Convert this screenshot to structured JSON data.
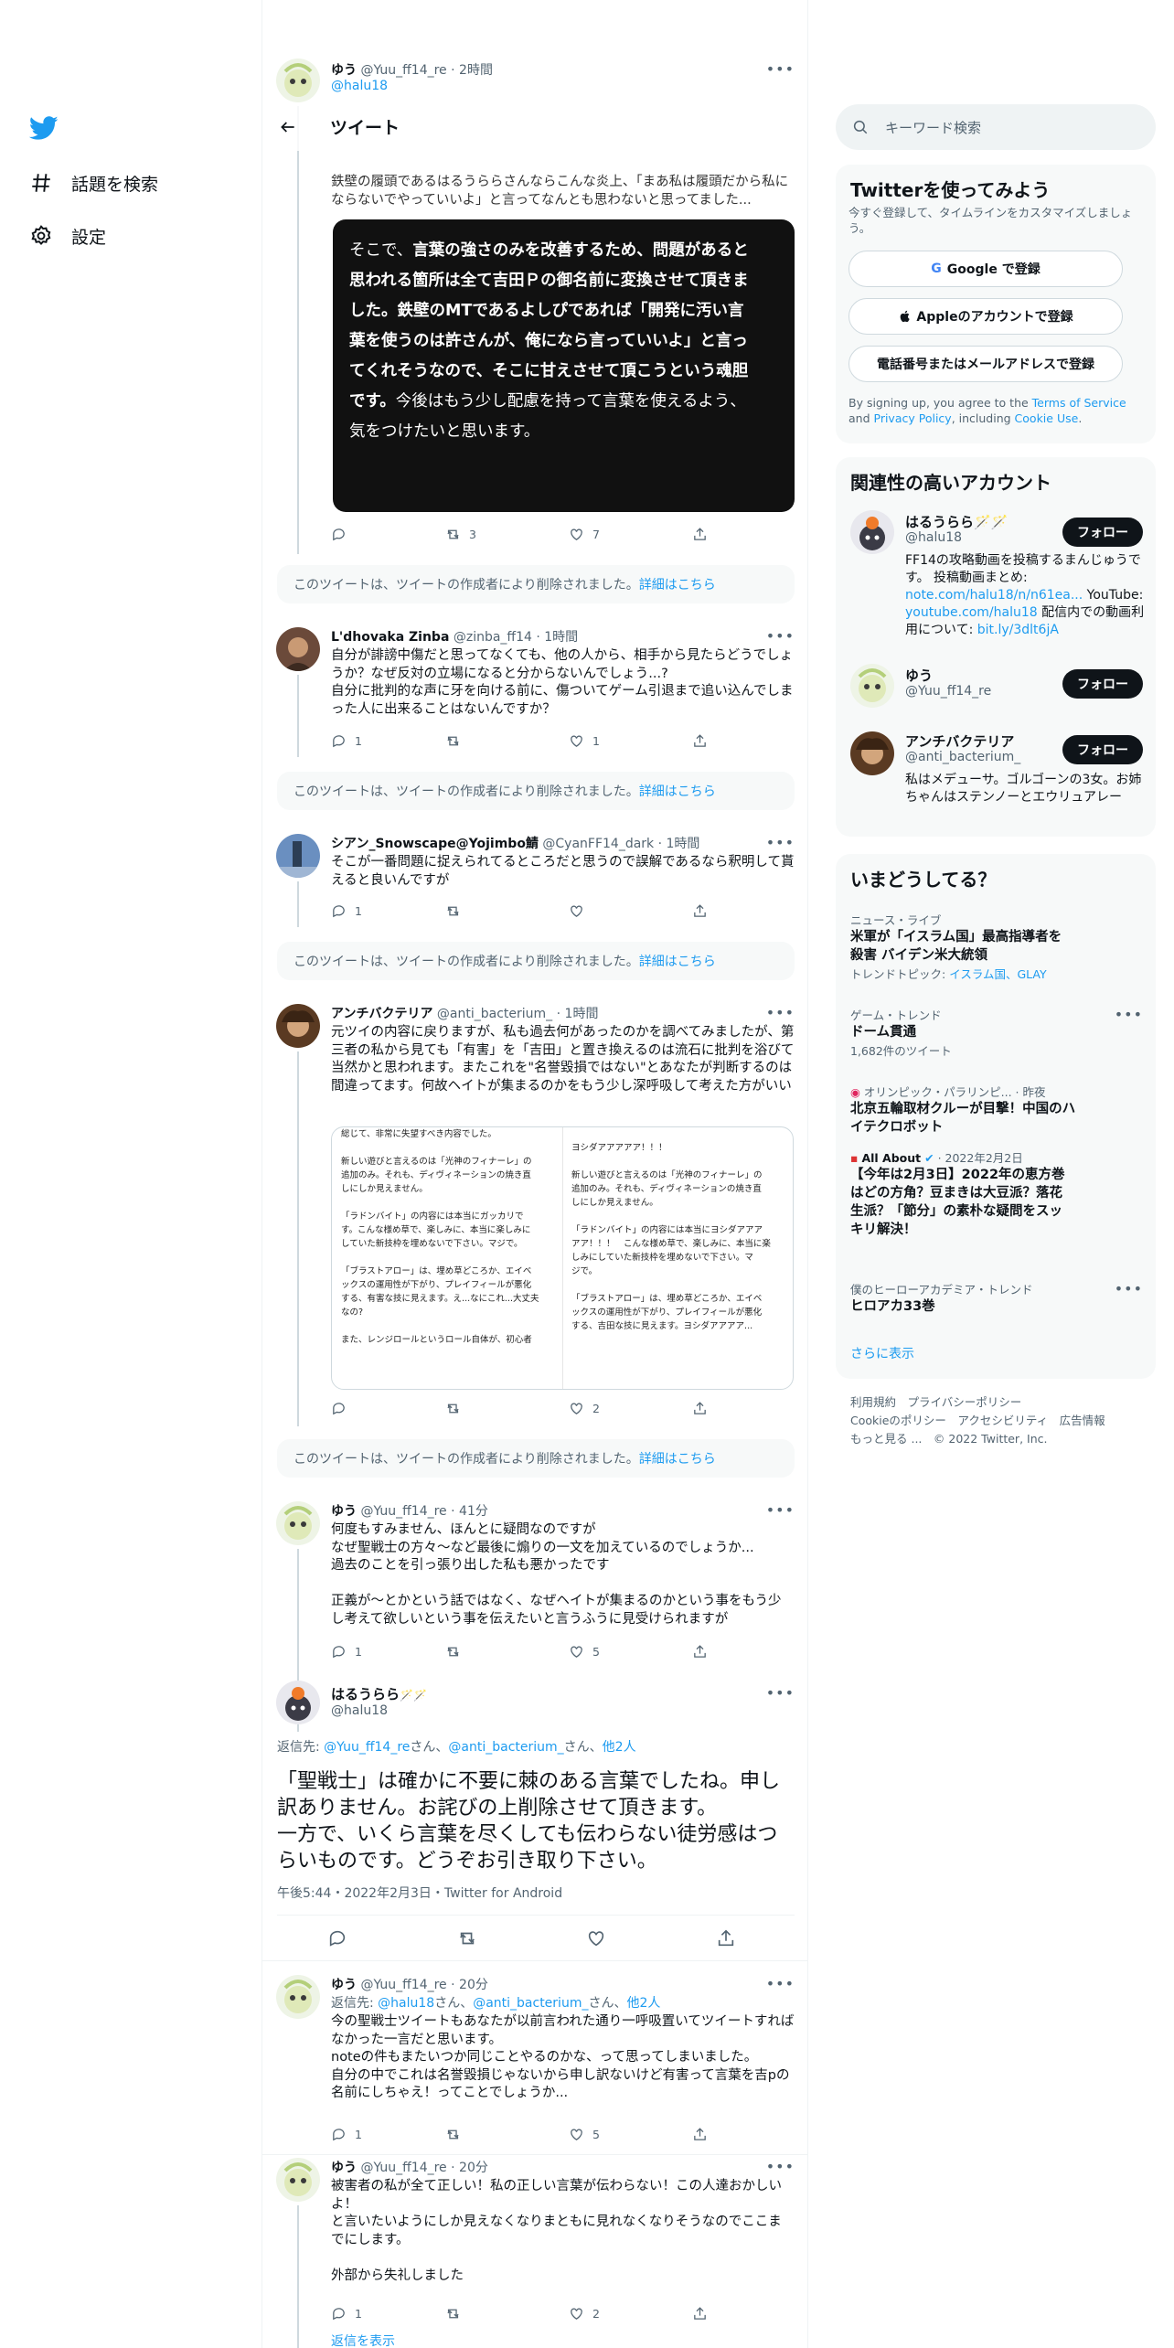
{
  "nav": {
    "explore_label": "話題を検索",
    "settings_label": "設定"
  },
  "header": {
    "title": "ツイート"
  },
  "tweets": [
    {
      "name": "ゆう",
      "handle": "@Yuu_ff14_re",
      "time": "2時間",
      "reply_to": "@halu18",
      "text": "鉄壁の履頭であるはるうららさんならこんな炎上、「まあ私は履頭だから私にならないでやっていいよ」と言ってなんとも思わないと思ってました...",
      "media_lines": [
        [
          "そこで、",
          "言葉の強さのみを改善するため、問題があると"
        ],
        [
          "",
          "思われる箇所は全て吉田Ｐの御名前に変換させて頂きま"
        ],
        [
          "",
          "した。鉄壁のMTであるよしぴであれば「開発に汚い言"
        ],
        [
          "",
          "葉を使うのは許さんが、俺になら言っていいよ」と言っ"
        ],
        [
          "",
          "てくれそうなので、そこに甘えさせて頂こうという魂胆"
        ],
        [
          "",
          "です。"
        ],
        [
          "",
          "気をつけたいと思います。"
        ]
      ],
      "media_tail": "今後はもう少し配慮を持って言葉を使えるよう、",
      "retweets": "3",
      "likes": "7"
    },
    {
      "name": "L'dhovaka Zinba",
      "handle": "@zinba_ff14",
      "time": "1時間",
      "text": "自分が誹謗中傷だと思ってなくても、他の人から、相手から見たらどうでしょうか？なぜ反対の立場になると分からないんでしょう...?\n自分に批判的な声に牙を向ける前に、傷ついてゲーム引退まで追い込んでしまった人に出来ることはないんですか？",
      "replies": "1",
      "likes": "1"
    },
    {
      "name": "シアン_Snowscape@Yojimbo鯖",
      "handle": "@CyanFF14_dark",
      "time": "1時間",
      "text": "そこが一番問題に捉えられてるところだと思うので誤解であるなら釈明して貰えると良いんですが",
      "replies": "1"
    },
    {
      "name": "アンチバクテリア",
      "handle": "@anti_bacterium_",
      "time": "1時間",
      "text": "元ツイの内容に戻りますが、私も過去何があったのかを調べてみましたが、第三者の私から見ても「有害」を「吉田」と置き換えるのは流石に批判を浴びて当然かと思われます。またこれを\"名誉毀損ではない\"とあなたが判断するのは間違ってます。何故ヘイトが集まるのかをもう少し深呼吸して考えた方がいい",
      "media_left": [
        "総じて、非常に失望すべき内容でした。",
        "",
        "新しい遊びと言えるのは「光神のフィナーレ」の",
        "追加のみ。それも、ディヴィネーションの焼き直",
        "しにしか見えません。",
        "",
        "「ラドンバイト」の内容には本当にガッカリで",
        "す。こんな様め草で、楽しみに、本当に楽しみに",
        "していた新技枠を埋めないで下さい。マジで。",
        "",
        "「ブラストアロー」は、埋め草どころか、エイベ",
        "ックスの運用性が下がり、プレイフィールが悪化",
        "する、有害な技に見えます。え...なにこれ...大丈夫",
        "なの?",
        "",
        "また、レンジロールというロール自体が、初心者"
      ],
      "media_right": [
        "",
        "ヨシダアアアアア！！！",
        "",
        "新しい遊びと言えるのは「光神のフィナーレ」の",
        "追加のみ。それも、ディヴィネーションの焼き直",
        "しにしか見えません。",
        "",
        "「ラドンバイト」の内容には本当にヨシダアアア",
        "アア！！！　こんな様め草で、楽しみに、本当に楽",
        "しみにしていた新技枠を埋めないで下さい。マ",
        "ジで。",
        "",
        "「ブラストアロー」は、埋め草どころか、エイベ",
        "ックスの運用性が下がり、プレイフィールが悪化",
        "する、吉田な技に見えます。ヨシダアアアア..."
      ],
      "likes": "2"
    },
    {
      "name": "ゆう",
      "handle": "@Yuu_ff14_re",
      "time": "41分",
      "text": "何度もすみません、ほんとに疑問なのですが\nなぜ聖戦士の方々〜など最後に煽りの一文を加えているのでしょうか...\n過去のことを引っ張り出した私も悪かったです\n\n正義が〜とかという話ではなく、なぜヘイトが集まるのかという事をもう少し考えて欲しいという事を伝えたいと言うふうに見受けられますが",
      "replies": "1",
      "likes": "5"
    }
  ],
  "deleted_notice": {
    "text": "このツイートは、ツイートの作成者により削除されました。",
    "link": "詳細はこちら"
  },
  "main_tweet": {
    "name": "はるうらら",
    "emoji": "🪄🪄",
    "handle": "@halu18",
    "reply_prefix": "返信先:",
    "reply_users": [
      "@Yuu_ff14_re",
      "@anti_bacterium_"
    ],
    "reply_san": "さん、",
    "reply_more": "他2人",
    "text": "「聖戦士」は確かに不要に棘のある言葉でしたね。申し訳ありません。お詫びの上削除させて頂きます。\n一方で、いくら言葉を尽くしても伝わらない徒労感はつらいものです。どうぞお引き取り下さい。",
    "meta": "午後5:44・2022年2月3日・Twitter for Android"
  },
  "replies_after": [
    {
      "name": "ゆう",
      "handle": "@Yuu_ff14_re",
      "time": "20分",
      "reply_prefix": "返信先:",
      "reply_users": [
        "@halu18",
        "@anti_bacterium_"
      ],
      "reply_san": "さん、",
      "reply_more": "他2人",
      "text": "今の聖戦士ツイートもあなたが以前言われた通り一呼吸置いてツイートすればなかった一言だと思います。\nnoteの件もまたいつか同じことやるのかな、って思ってしまいました。\n自分の中でこれは名誉毀損じゃないから申し訳ないけど有害って言葉を吉pの名前にしちゃえ！ってことでしょうか...",
      "replies": "1",
      "likes": "5"
    },
    {
      "name": "ゆう",
      "handle": "@Yuu_ff14_re",
      "time": "20分",
      "text": "被害者の私が全て正しい！私の正しい言葉が伝わらない！この人達おかしいよ！\nと言いたいようにしか見えなくなりまともに見れなくなりそうなのでここまでにします。\n\n外部から失礼しました",
      "replies": "1",
      "likes": "2",
      "show_replies": "返信を表示"
    }
  ],
  "right": {
    "search_placeholder": "キーワード検索",
    "signup": {
      "title": "Twitterを使ってみよう",
      "subtitle": "今すぐ登録して、タイムラインをカスタマイズしましょう。",
      "google": "Google で登録",
      "apple": "Appleのアカウントで登録",
      "phone": "電話番号またはメールアドレスで登録",
      "legal_pre": "By signing up, you agree to the ",
      "tos": "Terms of Service",
      "and": " and ",
      "privacy": "Privacy Policy",
      "including": ", including ",
      "cookie": "Cookie Use",
      "dot": "."
    },
    "related": {
      "title": "関連性の高いアカウント",
      "follow_label": "フォロー",
      "accounts": [
        {
          "name": "はるうらら🪄🪄",
          "handle": "@halu18",
          "bio_a": "FF14の攻略動画を投稿するまんじゅうです。 投稿動画まとめ:",
          "bio_link1": "note.com/halu18/n/n61ea...",
          "bio_b": " YouTube: ",
          "bio_link2": "youtube.com/halu18",
          "bio_c": " 配信内での動画利用について: ",
          "bio_link3": "bit.ly/3dlt6jA"
        },
        {
          "name": "ゆう",
          "handle": "@Yuu_ff14_re"
        },
        {
          "name": "アンチバクテリア",
          "handle": "@anti_bacterium_",
          "bio": "私はメデューサ。ゴルゴーンの3女。お姉ちゃんはステンノーとエウリュアレー"
        }
      ]
    },
    "trends": {
      "title": "いまどうしてる？",
      "items": [
        {
          "context": "ニュース・ライブ",
          "title": "米軍が「イスラム国」最高指導者を殺害 バイデン米大統領",
          "sub_prefix": "トレンドトピック: ",
          "sub_links": "イスラム国、GLAY"
        },
        {
          "context": "ゲーム・トレンド",
          "title": "ドーム貫通",
          "count": "1,682件のツイート"
        },
        {
          "context": "オリンピック・パラリンピ... · 昨夜",
          "title": "北京五輪取材クルーが目撃！中国のハイテクロボット"
        },
        {
          "context": "All About",
          "context_time": " · 2022年2月2日",
          "title": "【今年は2月3日】2022年の恵方巻はどの方角？豆まきは大豆派？落花生派？「節分」の素朴な疑問をスッキリ解決！"
        },
        {
          "context": "僕のヒーローアカデミア・トレンド",
          "title": "ヒロアカ33巻"
        }
      ],
      "show_more": "さらに表示"
    },
    "footer": {
      "line1": [
        "利用規約",
        "プライバシーポリシー"
      ],
      "line2": [
        "Cookieのポリシー",
        "アクセシビリティ",
        "広告情報"
      ],
      "more": "もっと見る ...",
      "copyright": "© 2022 Twitter, Inc."
    }
  },
  "colors": {
    "accent": "#1d9bf0",
    "text": "#0f1419",
    "muted": "#536471",
    "border": "#eff3f4"
  }
}
